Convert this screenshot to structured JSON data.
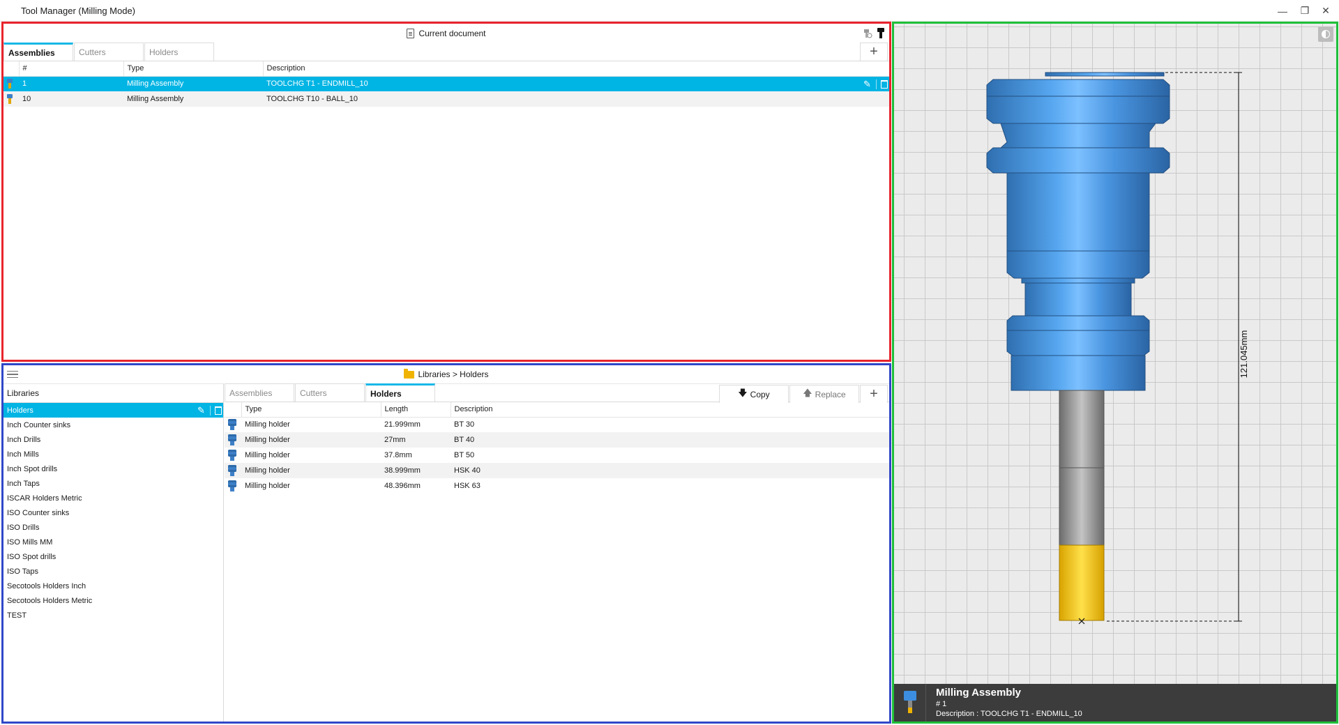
{
  "window": {
    "title": "Tool Manager (Milling Mode)",
    "minimize_glyph": "—",
    "restore_glyph": "❐",
    "close_glyph": "✕"
  },
  "document": {
    "title": "Current document",
    "tabs": [
      "Assemblies",
      "Cutters",
      "Holders"
    ],
    "active_tab": "Assemblies",
    "add_label": "+",
    "columns": [
      "#",
      "Type",
      "Description"
    ],
    "rows": [
      {
        "num": "1",
        "type": "Milling Assembly",
        "description": "TOOLCHG T1 - ENDMILL_10",
        "selected": true
      },
      {
        "num": "10",
        "type": "Milling Assembly",
        "description": "TOOLCHG T10 - BALL_10",
        "selected": false
      }
    ]
  },
  "library": {
    "breadcrumb": "Libraries > Holders",
    "libraries_header": "Libraries",
    "items": [
      "Holders",
      "Inch Counter sinks",
      "Inch Drills",
      "Inch Mills",
      "Inch Spot drills",
      "Inch Taps",
      "ISCAR Holders Metric",
      "ISO Counter sinks",
      "ISO Drills",
      "ISO Mills MM",
      "ISO Spot drills",
      "ISO Taps",
      "Secotools Holders Inch",
      "Secotools Holders Metric",
      "TEST"
    ],
    "selected_item": "Holders",
    "tabs": [
      "Assemblies",
      "Cutters",
      "Holders"
    ],
    "active_tab": "Holders",
    "copy_label": "Copy",
    "replace_label": "Replace",
    "add_label": "+",
    "columns": [
      "Type",
      "Length",
      "Description"
    ],
    "rows": [
      {
        "type": "Milling holder",
        "length": "21.999mm",
        "description": "BT 30"
      },
      {
        "type": "Milling holder",
        "length": "27mm",
        "description": "BT 40"
      },
      {
        "type": "Milling holder",
        "length": "37.8mm",
        "description": "BT 50"
      },
      {
        "type": "Milling holder",
        "length": "38.999mm",
        "description": "HSK 40"
      },
      {
        "type": "Milling holder",
        "length": "48.396mm",
        "description": "HSK 63"
      }
    ]
  },
  "preview": {
    "dimension": "121.045mm",
    "info_title": "Milling Assembly",
    "info_number": "# 1",
    "info_description": "Description :  TOOLCHG T1 - ENDMILL_10",
    "colors": {
      "holder": "#4a9ae6",
      "shank": "#8c8c8c",
      "cutter": "#f2c200",
      "accent": "#00b4e4"
    }
  }
}
